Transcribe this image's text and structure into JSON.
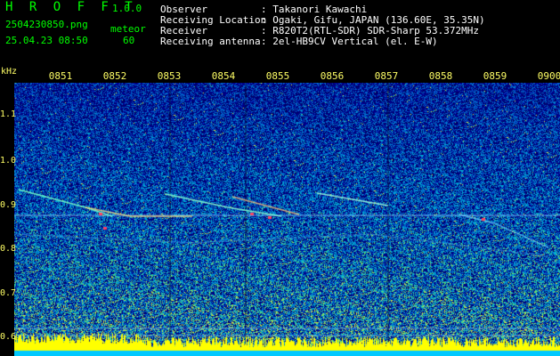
{
  "app": {
    "title": "H R O F F T",
    "version": "1.0.0"
  },
  "file": {
    "name": "2504230850.png",
    "datetime": "25.04.23 08:50"
  },
  "meteor": {
    "label": "meteor",
    "count": "60"
  },
  "info": [
    {
      "key": "Observer",
      "value": ": Takanori Kawachi"
    },
    {
      "key": "Receiving Location",
      "value": ": Ogaki, Gifu, JAPAN (136.60E, 35.35N)"
    },
    {
      "key": "Receiver",
      "value": ": R820T2(RTL-SDR) SDR-Sharp 53.372MHz"
    },
    {
      "key": "Receiving antenna",
      "value": ": 2el-HB9CV Vertical (el. E-W)"
    }
  ],
  "yaxis": {
    "unit": "kHz",
    "ticks": [
      "1.1",
      "1.0",
      "0.9",
      "0.8",
      "0.7",
      "0.6"
    ]
  },
  "xaxis": {
    "ticks": [
      "0851",
      "0852",
      "0853",
      "0854",
      "0855",
      "0856",
      "0857",
      "0858",
      "0859",
      "0900"
    ]
  },
  "colors": {
    "background": "#000000",
    "header_text": "#00ff00",
    "axis_text": "#ffff66",
    "info_text": "#ffffff"
  }
}
